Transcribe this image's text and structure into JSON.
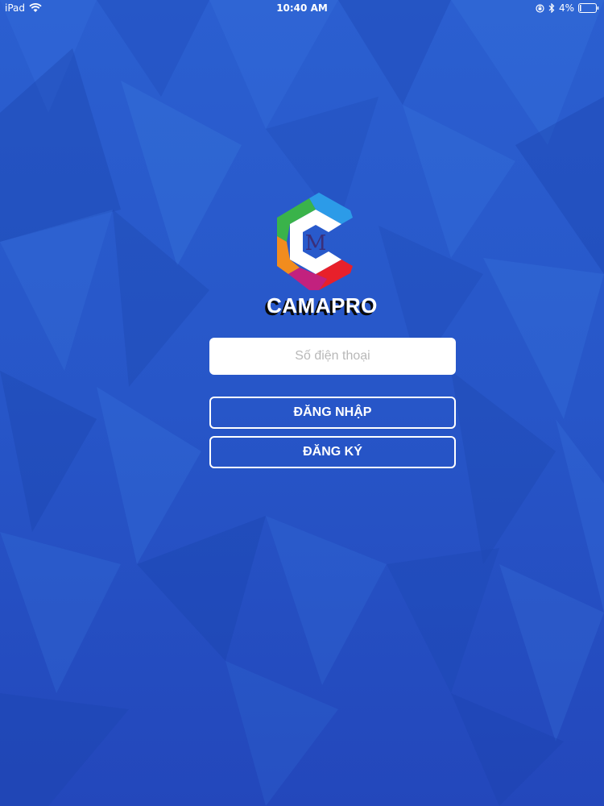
{
  "status_bar": {
    "device": "iPad",
    "time": "10:40 AM",
    "battery": "4%",
    "icons": [
      "wifi-icon",
      "orientation-lock-icon",
      "bluetooth-icon",
      "battery-icon"
    ]
  },
  "brand": {
    "name": "CAMAPRO",
    "logo_letter": "M",
    "logo_colors": [
      "#2c9be8",
      "#3ab34a",
      "#f28c1e",
      "#c2217e",
      "#e8202a"
    ]
  },
  "login_form": {
    "phone_placeholder": "Số điện thoại",
    "phone_value": "",
    "login_label": "ĐĂNG NHẬP",
    "register_label": "ĐĂNG KÝ"
  },
  "colors": {
    "background": "#2a56c9",
    "button_border": "#ffffff"
  }
}
